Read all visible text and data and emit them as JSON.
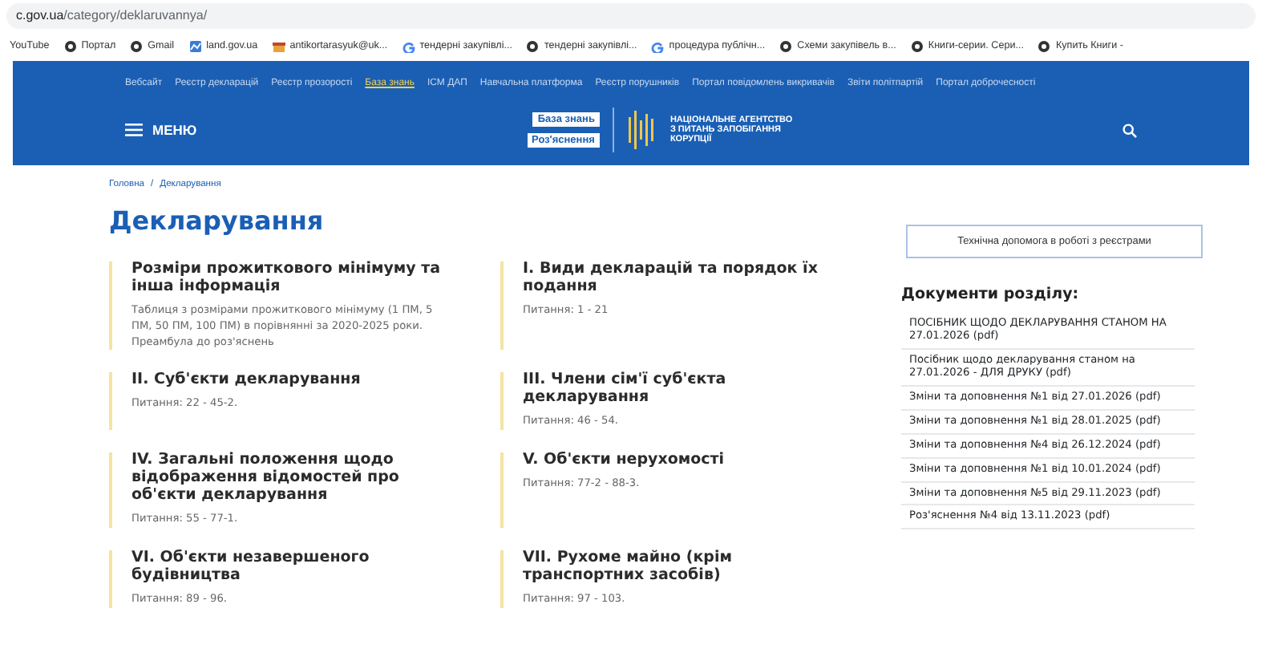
{
  "browser": {
    "url_host": "c.gov.ua",
    "url_path": "/category/deklaruvannya/",
    "bookmarks": [
      {
        "label": "YouTube",
        "kind": "plain"
      },
      {
        "label": "Портал",
        "kind": "globe"
      },
      {
        "label": "Gmail",
        "kind": "globe"
      },
      {
        "label": "land.gov.ua",
        "kind": "map"
      },
      {
        "label": "antikortarasyuk@uk...",
        "kind": "gift"
      },
      {
        "label": "тендерні закупівлі...",
        "kind": "g"
      },
      {
        "label": "тендерні закупівлі...",
        "kind": "globe"
      },
      {
        "label": "процедура публічн...",
        "kind": "g"
      },
      {
        "label": "Схеми закупівель в...",
        "kind": "globe"
      },
      {
        "label": "Книги-серии. Сери...",
        "kind": "globe"
      },
      {
        "label": "Купить Книги -",
        "kind": "globe"
      }
    ]
  },
  "header": {
    "top_links": [
      {
        "label": "Вебсайт",
        "selected": false
      },
      {
        "label": "Реєстр декларацій",
        "selected": false
      },
      {
        "label": "Реєстр прозорості",
        "selected": false
      },
      {
        "label": "База знань",
        "selected": true
      },
      {
        "label": "ІСМ ДАП",
        "selected": false
      },
      {
        "label": "Навчальна платформа",
        "selected": false
      },
      {
        "label": "Реєстр порушників",
        "selected": false
      },
      {
        "label": "Портал повідомлень викривачів",
        "selected": false
      },
      {
        "label": "Звіти політпартій",
        "selected": false
      },
      {
        "label": "Портал доброчесності",
        "selected": false
      }
    ],
    "menu": "МЕНЮ",
    "tags": [
      "База знань",
      "Роз'яснення"
    ],
    "logo_text": [
      "НАЦІОНАЛЬНЕ АГЕНТСТВО",
      "З ПИТАНЬ ЗАПОБІГАННЯ",
      "КОРУПЦІЇ"
    ]
  },
  "breadcrumb": {
    "items": [
      "Головна",
      "Декларування"
    ],
    "separator": "/"
  },
  "title": "Декларування",
  "sections": [
    {
      "title": "Розміри прожиткового мінімуму та інша інформація",
      "text": "Таблиця з розмірами прожиткового мінімуму (1 ПМ, 5 ПМ, 50 ПМ, 100 ПМ) в порівнянні за 2020-2025 роки. Преамбула до роз'яснень"
    },
    {
      "title": "І. Види декларацій та порядок їх подання",
      "text": "Питання: 1 - 21"
    },
    {
      "title": "ІІ. Суб'єкти декларування",
      "text": "Питання: 22 - 45-2."
    },
    {
      "title": "ІІІ. Члени сім'ї суб'єкта декларування",
      "text": "Питання: 46 - 54."
    },
    {
      "title": "IV. Загальні положення щодо відображення відомостей про об'єкти декларування",
      "text": "Питання: 55 - 77-1."
    },
    {
      "title": "V. Об'єкти нерухомості",
      "text": "Питання: 77-2 - 88-3."
    },
    {
      "title": "VI. Об'єкти незавершеного будівництва",
      "text": "Питання: 89 - 96."
    },
    {
      "title": "VII. Рухоме майно (крім транспортних засобів)",
      "text": "Питання: 97 - 103."
    }
  ],
  "help_button": "Технічна допомога в роботі з реєстрами",
  "documents": {
    "title": "Документи розділу:",
    "items": [
      "ПОСІБНИК ЩОДО ДЕКЛАРУВАННЯ СТАНОМ НА 27.01.2026 (pdf)",
      "Посібник щодо декларування станом на 27.01.2026 - ДЛЯ ДРУКУ (pdf)",
      "Зміни та доповнення №1 від 27.01.2026 (pdf)",
      "Зміни та доповнення №1 від 28.01.2025 (pdf)",
      "Зміни та доповнення №4 від 26.12.2024 (pdf)",
      "Зміни та доповнення №1 від 10.01.2024 (pdf)",
      "Зміни та доповнення №5 від 29.11.2023 (pdf)",
      "Роз'яснення №4 від 13.11.2023 (pdf)"
    ]
  }
}
